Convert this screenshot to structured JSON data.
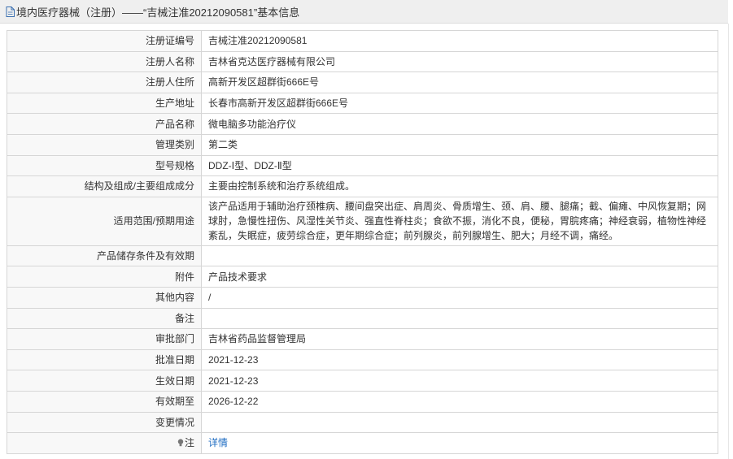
{
  "header": {
    "icon": "document-icon",
    "title": "境内医疗器械（注册）——“吉械注准20212090581”基本信息"
  },
  "rows": [
    {
      "label": "注册证编号",
      "value": "吉械注准20212090581"
    },
    {
      "label": "注册人名称",
      "value": "吉林省克达医疗器械有限公司"
    },
    {
      "label": "注册人住所",
      "value": "高新开发区超群街666E号"
    },
    {
      "label": "生产地址",
      "value": "长春市高新开发区超群街666E号"
    },
    {
      "label": "产品名称",
      "value": "微电脑多功能治疗仪"
    },
    {
      "label": "管理类别",
      "value": "第二类"
    },
    {
      "label": "型号规格",
      "value": "DDZ-Ⅰ型、DDZ-Ⅱ型"
    },
    {
      "label": "结构及组成/主要组成成分",
      "value": "主要由控制系统和治疗系统组成。"
    },
    {
      "label": "适用范围/预期用途",
      "value": "该产品适用于辅助治疗颈椎病、腰间盘突出症、肩周炎、骨质增生、颈、肩、腰、腿痛；截、偏瘫、中风恢复期；网球肘，急慢性扭伤、风湿性关节炎、强直性脊柱炎；食欲不振，消化不良，便秘，胃脘疼痛；神经衰弱，植物性神经紊乱，失眠症，疲劳综合症，更年期综合症；前列腺炎，前列腺增生、肥大；月经不调，痛经。"
    },
    {
      "label": "产品储存条件及有效期",
      "value": ""
    },
    {
      "label": "附件",
      "value": "产品技术要求"
    },
    {
      "label": "其他内容",
      "value": "/"
    },
    {
      "label": "备注",
      "value": ""
    },
    {
      "label": "审批部门",
      "value": "吉林省药品监督管理局"
    },
    {
      "label": "批准日期",
      "value": "2021-12-23"
    },
    {
      "label": "生效日期",
      "value": "2021-12-23"
    },
    {
      "label": "有效期至",
      "value": "2026-12-22"
    },
    {
      "label": "变更情况",
      "value": ""
    }
  ],
  "note_row": {
    "icon": "lightbulb-icon",
    "label": "注",
    "link_text": "详情"
  },
  "colors": {
    "link": "#1e6cc2",
    "label_bg": "#f8f8f8",
    "border": "#d6d6d6",
    "header_bg": "#efefef"
  }
}
